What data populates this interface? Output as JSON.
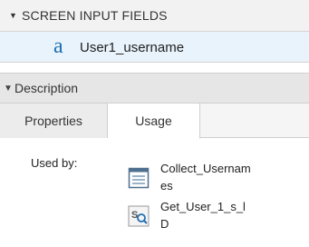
{
  "screen_input_fields": {
    "title": "SCREEN INPUT FIELDS",
    "items": [
      {
        "icon": "text-field-icon",
        "icon_glyph": "a",
        "label": "User1_username"
      }
    ]
  },
  "description": {
    "title": "Description",
    "tabs": [
      {
        "label": "Properties",
        "selected": false
      },
      {
        "label": "Usage",
        "selected": true
      }
    ]
  },
  "usage": {
    "used_by_label": "Used by:",
    "items": [
      {
        "icon": "screen-element-icon",
        "name_line1": "Collect_Usernam",
        "name_line2": "es"
      },
      {
        "icon": "record-lookup-icon",
        "name_line1": "Get_User_1_s_l",
        "name_line2": "D"
      }
    ]
  },
  "colors": {
    "header_bg": "#f2f2f2",
    "selected_row_bg": "#e8f3fc",
    "icon_blue": "#1f6fb2"
  }
}
